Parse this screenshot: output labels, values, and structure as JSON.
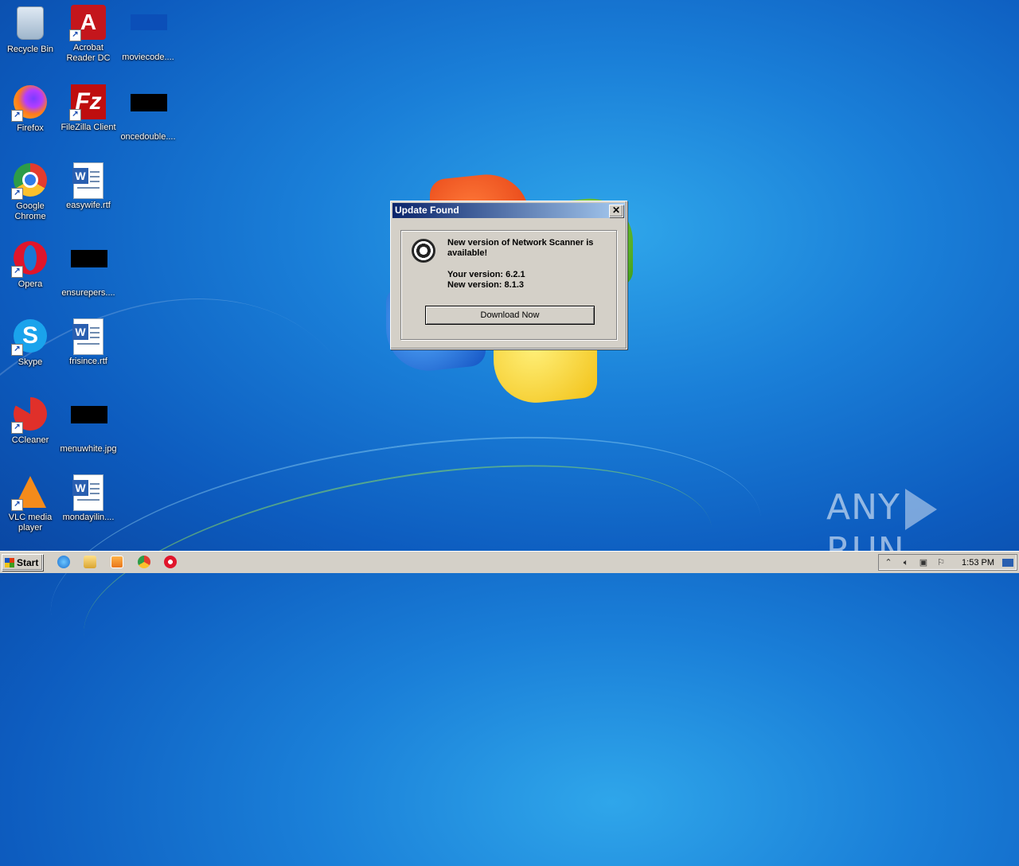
{
  "desktop": {
    "icons": [
      {
        "label": "Recycle Bin"
      },
      {
        "label": "Acrobat Reader DC"
      },
      {
        "label": "moviecode...."
      },
      {
        "label": "Firefox"
      },
      {
        "label": "FileZilla Client"
      },
      {
        "label": "oncedouble...."
      },
      {
        "label": "Google Chrome"
      },
      {
        "label": "easywife.rtf"
      },
      {
        "label": "Opera"
      },
      {
        "label": "ensurepers...."
      },
      {
        "label": "Skype"
      },
      {
        "label": "frisince.rtf"
      },
      {
        "label": "CCleaner"
      },
      {
        "label": "menuwhite.jpg"
      },
      {
        "label": "VLC media player"
      },
      {
        "label": "mondayilin...."
      }
    ]
  },
  "dialog": {
    "title": "Update Found",
    "close_label": "✕",
    "message": "New version of Network Scanner is available!",
    "your_version": "Your version: 6.2.1",
    "new_version": "New version: 8.1.3",
    "download_label": "Download Now"
  },
  "watermark": {
    "left": "ANY",
    "right": "RUN"
  },
  "taskbar": {
    "start_label": "Start",
    "pinned": [
      "ie-icon",
      "explorer-icon",
      "media-player-icon",
      "chrome-icon",
      "opera-icon"
    ],
    "clock": "1:53 PM"
  }
}
